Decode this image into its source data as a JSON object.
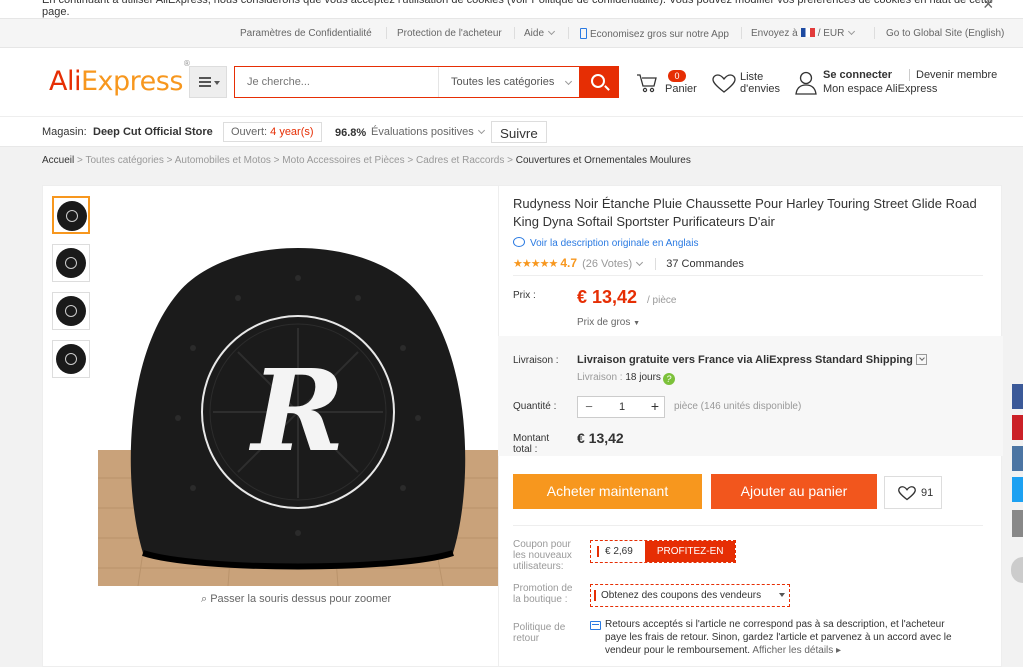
{
  "cookie": {
    "text": "En continuant à utiliser AliExpress, nous considérons que vous acceptez l'utilisation de cookies (voir Politique de confidentialité). Vous pouvez modifier vos préférences de cookies en haut de cette page.",
    "close": "×"
  },
  "topnav": {
    "privacy": "Paramètres de Confidentialité",
    "buyer_protection": "Protection de l'acheteur",
    "help": "Aide",
    "app": "Economisez gros sur notre App",
    "ship_to": "Envoyez à",
    "currency": "/ EUR",
    "global_site": "Go to Global Site (English)"
  },
  "header": {
    "logo_a": "Ali",
    "logo_b": "Express",
    "logo_tm": "®",
    "search_placeholder": "Je cherche...",
    "category": "Toutes les catégories",
    "cart_count": "0",
    "cart_label": "Panier",
    "wish_l1": "Liste",
    "wish_l2": "d'envies",
    "signin": "Se connecter",
    "member": "Devenir membre",
    "myaccount": "Mon espace AliExpress"
  },
  "store": {
    "label": "Magasin:",
    "name": "Deep Cut Official Store",
    "opened": "Ouvert:",
    "years": "4 year(s)",
    "positive_pct": "96.8%",
    "positive_label": "Évaluations positives",
    "follow": "Suivre"
  },
  "breadcrumb": {
    "home": "Accueil",
    "items": [
      "Toutes catégories",
      "Automobiles et Motos",
      "Moto Accessoires et Pièces",
      "Cadres et Raccords"
    ],
    "last": "Couvertures et Ornementales Moulures",
    "sep": " > "
  },
  "gallery": {
    "zoom_hint": "Passer la souris dessus pour zoomer",
    "logo_letter": "R",
    "thumb_count": 4,
    "selected_thumb": 1
  },
  "product": {
    "title": "Rudyness Noir Étanche Pluie Chaussette Pour Harley Touring Street Glide Road King Dyna Softail Sportster Purificateurs D'air",
    "orig_desc": "Voir la description originale en Anglais",
    "stars": "★★★★★",
    "score": "4.7",
    "votes": "(26 Votes)",
    "orders": "37 Commandes",
    "rating_value": 4.7,
    "price_label": "Prix :",
    "price": "€ 13,42",
    "per_piece": "/ pièce",
    "bulk": "Prix de gros",
    "shipping_label": "Livraison :",
    "shipping_free": "Livraison gratuite vers",
    "shipping_rest": " France via AliExpress Standard Shipping",
    "delay_label": "Livraison : ",
    "delay_value": "18 jours",
    "qty_label": "Quantité :",
    "qty_value": "1",
    "qty_minus": "−",
    "qty_plus": "+",
    "available": "pièce (146 unités disponible)",
    "total_label_1": "Montant",
    "total_label_2": "total :",
    "total": "€ 13,42",
    "buy_now": "Acheter maintenant",
    "add_to_cart": "Ajouter au panier",
    "wish_count": "91",
    "coupon_label": "Coupon pour les nouveaux utilisateurs:",
    "coupon_amount": "€ 2,69",
    "coupon_cta": "PROFITEZ-EN",
    "store_promo_label": "Promotion de la boutique :",
    "store_promo": "Obtenez des coupons des vendeurs",
    "return_label": "Politique de retour",
    "return_text": "Retours acceptés si l'article ne correspond pas à sa description, et l'acheteur paye les frais de retour. Sinon, gardez l'article et parvenez à un accord avec le vendeur pour le remboursement.",
    "return_more": "Afficher les détails ▸"
  },
  "colors": {
    "brand_red": "#e62e04",
    "brand_orange": "#f7971e",
    "cart_orange": "#f2561d",
    "link_blue": "#2a7ae2"
  }
}
